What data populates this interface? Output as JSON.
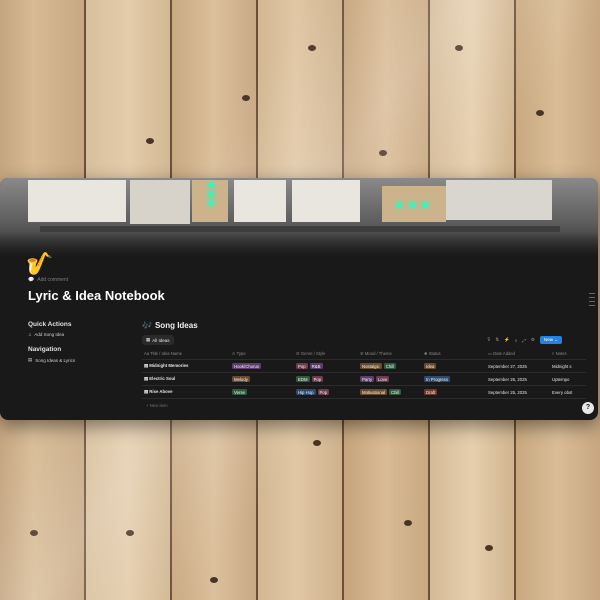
{
  "page": {
    "icon": "🎷",
    "add_comment": "Add comment",
    "title": "Lyric & Idea Notebook"
  },
  "sidebar": {
    "quick_actions_title": "Quick Actions",
    "quick_actions": [
      {
        "icon": "music-note-icon",
        "label": "Add Song Idea"
      }
    ],
    "navigation_title": "Navigation",
    "navigation": [
      {
        "icon": "database-icon",
        "label": "Song Ideas & Lyrics"
      }
    ]
  },
  "database": {
    "icon": "🎶",
    "title": "Song Ideas",
    "view_tab": "All Ideas",
    "new_button": "New",
    "columns": [
      "Title / Idea Name",
      "Type",
      "Genre / Style",
      "Mood / Theme",
      "Status",
      "Date Added",
      "Notes"
    ],
    "rows": [
      {
        "title": "Midnight Memories",
        "type": {
          "label": "Hook/Chorus",
          "color": "#5b3d6e"
        },
        "genre": [
          {
            "label": "Pop",
            "color": "#6e3a4f"
          },
          {
            "label": "R&B",
            "color": "#5b3d6e"
          }
        ],
        "mood": [
          {
            "label": "Nostalgic",
            "color": "#6b4a2a"
          },
          {
            "label": "Chill",
            "color": "#2f5a3d"
          }
        ],
        "status": {
          "label": "Idea",
          "color": "#6b4a2a"
        },
        "date": "September 27, 2025",
        "notes": "Midnight s"
      },
      {
        "title": "Electric Soul",
        "type": {
          "label": "Melody",
          "color": "#6b4a2a"
        },
        "genre": [
          {
            "label": "EDM",
            "color": "#2f5a3d"
          },
          {
            "label": "Pop",
            "color": "#6e3a4f"
          }
        ],
        "mood": [
          {
            "label": "Party",
            "color": "#5b3d6e"
          },
          {
            "label": "Love",
            "color": "#6e3a4f"
          }
        ],
        "status": {
          "label": "In Progress",
          "color": "#2a4a6e"
        },
        "date": "September 26, 2025",
        "notes": "Uptempo"
      },
      {
        "title": "Rise Above",
        "type": {
          "label": "Verse",
          "color": "#2f5a3d"
        },
        "genre": [
          {
            "label": "Hip Hop",
            "color": "#2a4a6e"
          },
          {
            "label": "Pop",
            "color": "#6e3a4f"
          }
        ],
        "mood": [
          {
            "label": "Motivational",
            "color": "#6b4a2a"
          },
          {
            "label": "Chill",
            "color": "#2f5a3d"
          }
        ],
        "status": {
          "label": "Draft",
          "color": "#6e3a2a"
        },
        "date": "September 25, 2025",
        "notes": "Every obst"
      }
    ],
    "new_page": "New item"
  },
  "help_button": "?"
}
